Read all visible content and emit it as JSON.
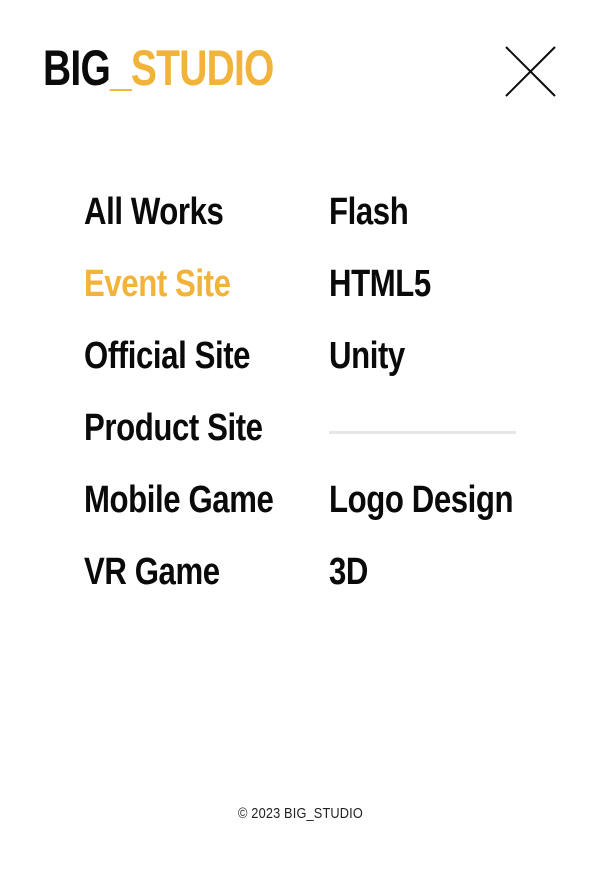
{
  "colors": {
    "accent": "#f2b33a",
    "text": "#0a0a0a",
    "divider": "#e6e6e6"
  },
  "logo": {
    "part1": "BIG",
    "part2": "_STUDIO"
  },
  "close": {
    "icon": "close-icon"
  },
  "menu": {
    "left": [
      {
        "label": "All Works",
        "active": false
      },
      {
        "label": "Event Site",
        "active": true
      },
      {
        "label": "Official Site",
        "active": false
      },
      {
        "label": "Product Site",
        "active": false
      },
      {
        "label": "Mobile Game",
        "active": false
      },
      {
        "label": "VR Game",
        "active": false
      }
    ],
    "right_top": [
      {
        "label": "Flash"
      },
      {
        "label": "HTML5"
      },
      {
        "label": "Unity"
      }
    ],
    "right_bottom": [
      {
        "label": "Logo Design"
      },
      {
        "label": "3D"
      }
    ]
  },
  "footer": {
    "copyright": "© 2023 BIG_STUDIO"
  }
}
